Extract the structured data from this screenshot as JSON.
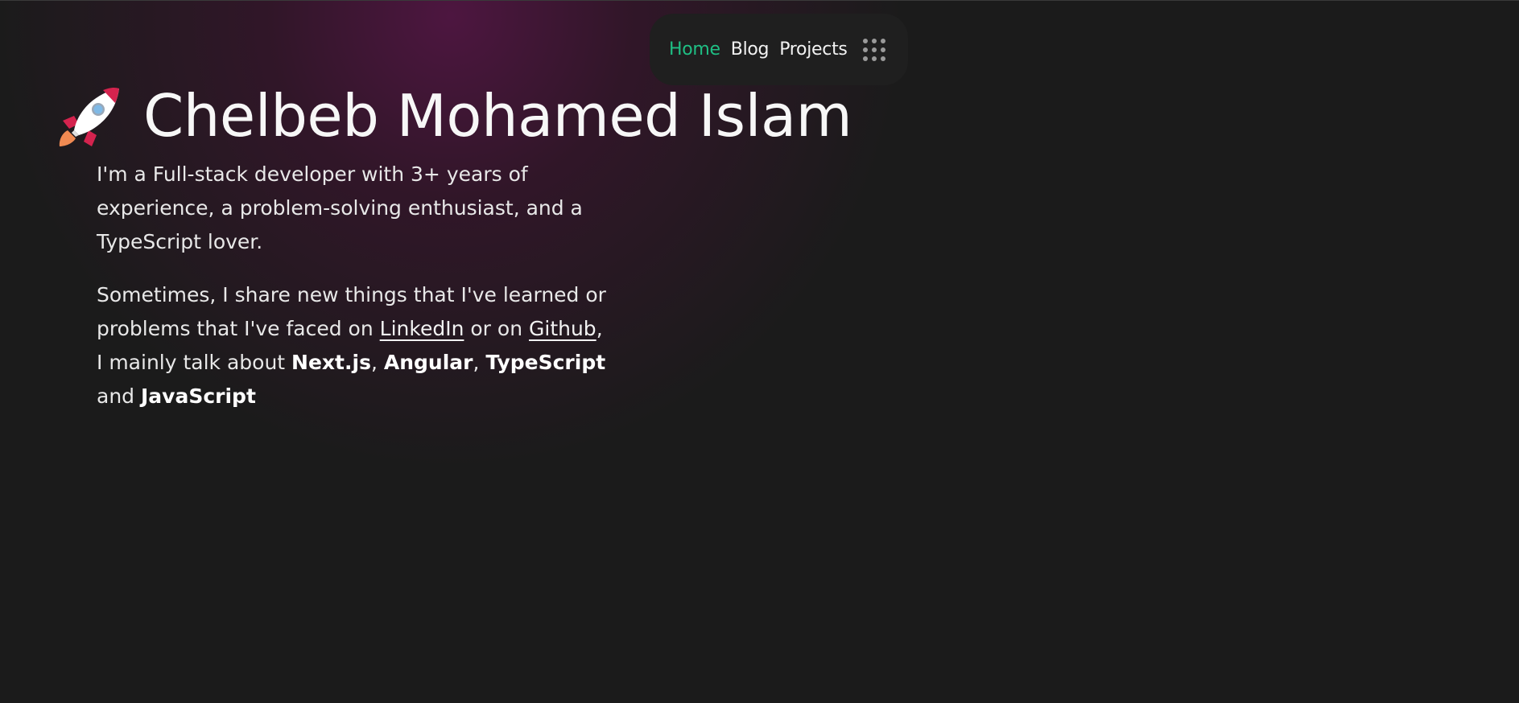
{
  "nav": {
    "items": [
      {
        "label": "Home",
        "active": true
      },
      {
        "label": "Blog",
        "active": false
      },
      {
        "label": "Projects",
        "active": false
      }
    ],
    "menu_icon": "grid-dots-icon",
    "active_color": "#1fbf84"
  },
  "hero": {
    "icon": "rocket-icon",
    "title": "Chelbeb Mohamed Islam"
  },
  "intro": {
    "paragraph1": "I'm a Full-stack developer with 3+ years of experience, a problem-solving enthusiast, and a TypeScript lover.",
    "p2_text1": "Sometimes, I share new things that I've learned or problems that I've faced on ",
    "linkedin_label": "LinkedIn",
    "p2_text2": " or on ",
    "github_label": "Github",
    "p2_text3": ", I mainly talk about ",
    "tech1": "Next.js",
    "sep1": ", ",
    "tech2": "Angular",
    "sep2": ", ",
    "tech3": "TypeScript",
    "sep3": " and ",
    "tech4": "JavaScript"
  },
  "colors": {
    "background": "#1b1b1b",
    "glow": "#501642",
    "nav_background": "#1f1f1f"
  }
}
